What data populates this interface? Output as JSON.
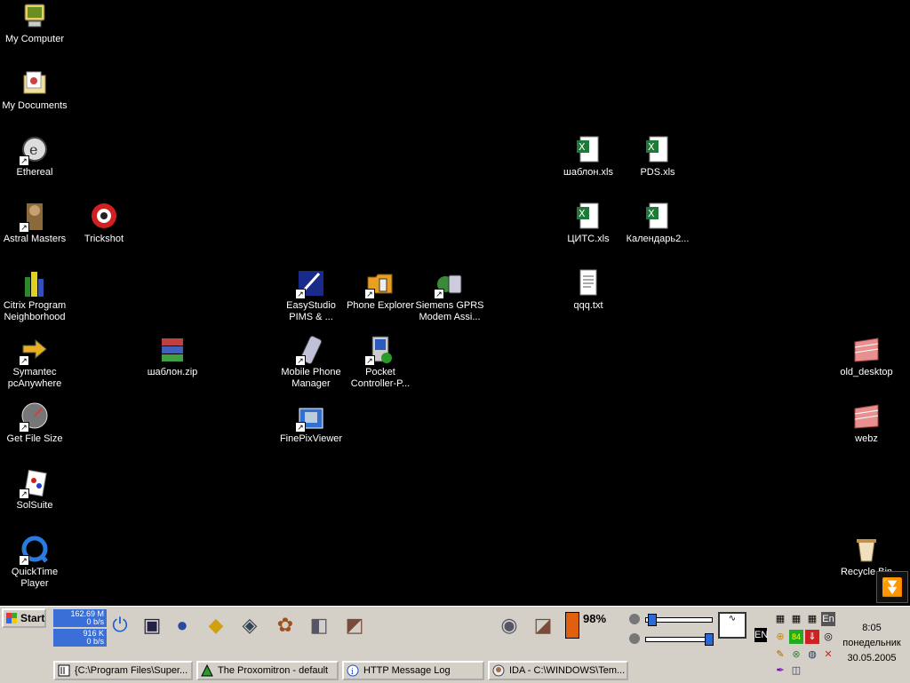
{
  "desktop_icons": [
    {
      "label": "My Computer",
      "icon": "my-computer-icon"
    },
    {
      "label": "My Documents",
      "icon": "my-documents-icon"
    },
    {
      "label": "Ethereal",
      "icon": "ethereal-icon"
    },
    {
      "label": "Astral Masters",
      "icon": "astral-masters-icon"
    },
    {
      "label": "Trickshot",
      "icon": "trickshot-icon"
    },
    {
      "label": "Citrix Program\nNeighborhood",
      "icon": "citrix-icon"
    },
    {
      "label": "Symantec\npcAnywhere",
      "icon": "pcanywhere-icon"
    },
    {
      "label": "шаблон.zip",
      "icon": "winrar-archive-icon"
    },
    {
      "label": "Get File Size",
      "icon": "gauge-icon"
    },
    {
      "label": "SolSuite",
      "icon": "cards-icon"
    },
    {
      "label": "QuickTime\nPlayer",
      "icon": "quicktime-icon"
    },
    {
      "label": "EasyStudio\nPIMS & ...",
      "icon": "easystudio-icon"
    },
    {
      "label": "Mobile Phone\nManager",
      "icon": "mobile-phone-icon"
    },
    {
      "label": "FinePixViewer",
      "icon": "finepix-icon"
    },
    {
      "label": "Phone Explorer",
      "icon": "folder-phone-icon"
    },
    {
      "label": "Pocket\nController-P...",
      "icon": "pocket-controller-icon"
    },
    {
      "label": "Siemens GPRS\nModem Assi...",
      "icon": "siemens-modem-icon"
    },
    {
      "label": "шаблон.xls",
      "icon": "excel-file-icon"
    },
    {
      "label": "ЦИТС.xls",
      "icon": "excel-file-icon"
    },
    {
      "label": "qqq.txt",
      "icon": "text-file-icon"
    },
    {
      "label": "PDS.xls",
      "icon": "excel-file-icon"
    },
    {
      "label": "Календарь2...",
      "icon": "excel-file-icon"
    },
    {
      "label": "old_desktop",
      "icon": "folder-stack-icon"
    },
    {
      "label": "webz",
      "icon": "folder-stack-icon"
    },
    {
      "label": "Recycle Bin",
      "icon": "recycle-bin-icon"
    }
  ],
  "taskbar": {
    "start_label": "Start",
    "net_down": "162.69 M",
    "net_down_rate": "0 b/s",
    "net_up": "916 K",
    "net_up_rate": "0 b/s",
    "battery": "98%",
    "language": "EN",
    "tray_lang": "En",
    "tray_badge": "84",
    "clock_time": "8:05",
    "clock_day": "понедельник",
    "clock_date": "30.05.2005",
    "tasks": [
      {
        "label": "{C:\\Program Files\\Super...",
        "icon": "app-window-icon"
      },
      {
        "label": "The Proxomitron - default",
        "icon": "proxomitron-icon"
      },
      {
        "label": "HTTP Message Log",
        "icon": "info-icon"
      },
      {
        "label": "IDA - C:\\WINDOWS\\Tem...",
        "icon": "ida-icon"
      }
    ]
  }
}
